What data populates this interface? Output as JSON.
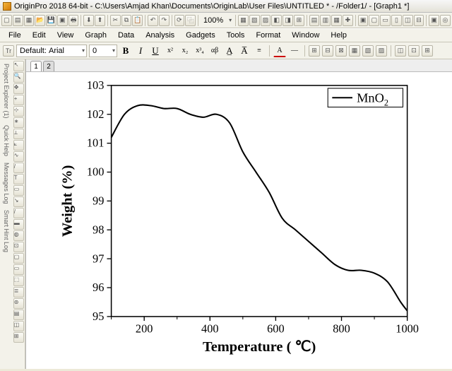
{
  "window_title": "OriginPro 2018 64-bit - C:\\Users\\Amjad Khan\\Documents\\OriginLab\\User Files\\UNTITLED * - /Folder1/ - [Graph1 *]",
  "menu": [
    "File",
    "Edit",
    "View",
    "Graph",
    "Data",
    "Analysis",
    "Gadgets",
    "Tools",
    "Format",
    "Window",
    "Help"
  ],
  "top_toolbar": {
    "zoom": "100%"
  },
  "format_bar": {
    "font_prefix": "Default:",
    "font_name": "Arial",
    "font_size": "0"
  },
  "sheet_tabs": [
    "1",
    "2"
  ],
  "left_panel_labels": [
    "Project Explorer (1)",
    "Quick Help",
    "Messages Log",
    "Smart Hint Log"
  ],
  "legend_label": "MnO",
  "legend_sub": "2",
  "chart_data": {
    "type": "line",
    "title": "",
    "xlabel": "Temperature ( ℃)",
    "ylabel": "Weight (%)",
    "xlim": [
      100,
      1000
    ],
    "ylim": [
      95,
      103
    ],
    "x_ticks": [
      200,
      400,
      600,
      800,
      1000
    ],
    "y_ticks": [
      95,
      96,
      97,
      98,
      99,
      100,
      101,
      102,
      103
    ],
    "series": [
      {
        "name": "MnO2",
        "x": [
          100,
          140,
          180,
          220,
          260,
          300,
          340,
          380,
          420,
          460,
          500,
          540,
          580,
          620,
          660,
          700,
          740,
          780,
          820,
          860,
          900,
          940,
          980,
          1000
        ],
        "y": [
          101.2,
          102.0,
          102.3,
          102.3,
          102.2,
          102.2,
          102.0,
          101.9,
          102.0,
          101.7,
          100.7,
          100.0,
          99.3,
          98.4,
          98.0,
          97.6,
          97.2,
          96.8,
          96.6,
          96.6,
          96.5,
          96.2,
          95.5,
          95.2
        ]
      }
    ]
  }
}
